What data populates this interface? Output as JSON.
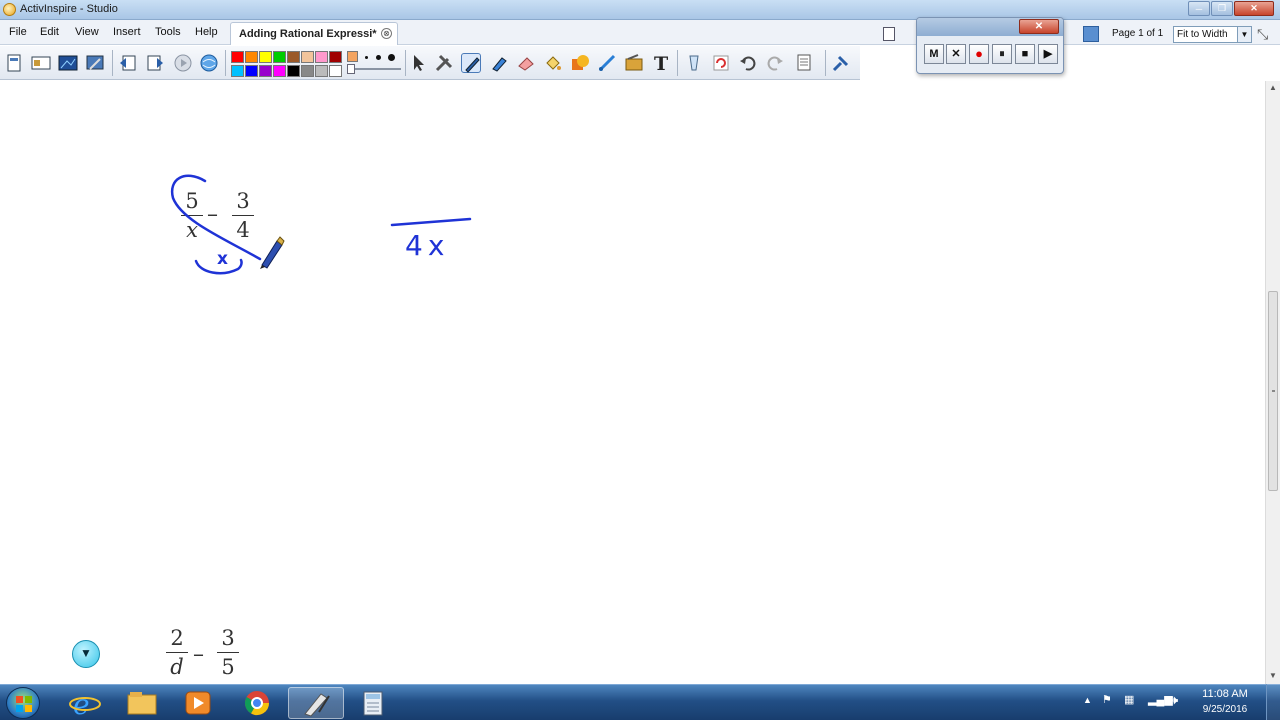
{
  "window": {
    "title": "ActivInspire - Studio",
    "controls": [
      "minimize",
      "restore",
      "close"
    ]
  },
  "menu": {
    "items": [
      "File",
      "Edit",
      "View",
      "Insert",
      "Tools",
      "Help"
    ]
  },
  "document_tab": {
    "label": "Adding Rational Expressi*",
    "close_glyph": "⊗"
  },
  "page_nav": {
    "indicator": "Page 1 of 1",
    "zoom": "Fit to Width"
  },
  "toolbar": {
    "tools": [
      "new-page-icon",
      "page-browser-icon",
      "display-icon",
      "settings-icon",
      "previous-page-icon",
      "next-page-icon",
      "play-icon",
      "internet-icon",
      "select-icon",
      "tools-icon",
      "pen-icon",
      "highlighter-icon",
      "eraser-icon",
      "fill-icon",
      "shape-icon",
      "connector-icon",
      "clipboard-icon",
      "text-icon",
      "clear-icon",
      "reset-icon",
      "undo-icon",
      "redo-icon",
      "page-list-icon",
      "pin-icon"
    ],
    "palette": [
      "#ff0000",
      "#ff8800",
      "#ffff00",
      "#00cc00",
      "#9b5a2a",
      "#f2c49b",
      "#ff99cc",
      "#a00000",
      "#00c0ff",
      "#0000ff",
      "#9900cc",
      "#ff00ff",
      "#000000",
      "#888888",
      "#bbbbbb",
      "#ffffff"
    ],
    "selected_tool": "pen-icon"
  },
  "recorder": {
    "buttons": [
      "M",
      "✕",
      "●",
      "⏸",
      "■",
      "▶"
    ],
    "close_glyph": "✕"
  },
  "canvas": {
    "problem1": {
      "fraction1": {
        "numerator": "5",
        "denominator": "x"
      },
      "fraction2": {
        "numerator": "3",
        "denominator": "4"
      },
      "operator": "–"
    },
    "work": {
      "denominator": "4x",
      "circled_factor": "x"
    },
    "problem2": {
      "fraction1": {
        "numerator": "2",
        "denominator": "d"
      },
      "fraction2": {
        "numerator": "3",
        "denominator": "5"
      },
      "operator": "–"
    },
    "ink_color": "#1f33d6"
  },
  "taskbar": {
    "apps": [
      "internet-explorer-icon",
      "file-explorer-icon",
      "media-player-icon",
      "chrome-icon",
      "activinspire-icon",
      "calculator-icon"
    ],
    "active_app": "activinspire-icon",
    "clock": {
      "time": "11:08 AM",
      "date": "9/25/2016"
    }
  }
}
